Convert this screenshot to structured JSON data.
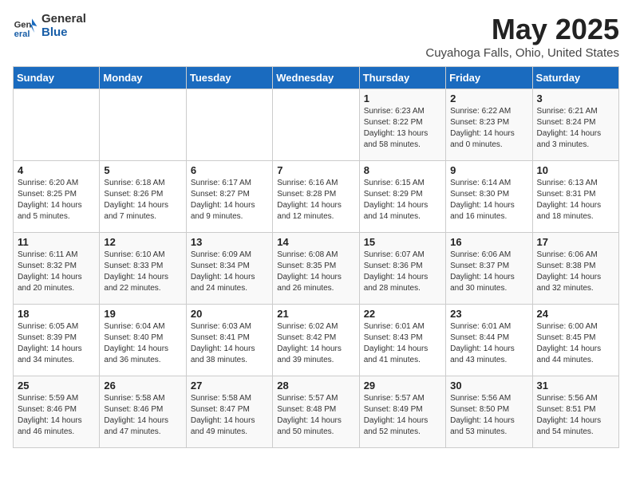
{
  "header": {
    "logo_general": "General",
    "logo_blue": "Blue",
    "title": "May 2025",
    "subtitle": "Cuyahoga Falls, Ohio, United States"
  },
  "weekdays": [
    "Sunday",
    "Monday",
    "Tuesday",
    "Wednesday",
    "Thursday",
    "Friday",
    "Saturday"
  ],
  "weeks": [
    [
      {
        "day": "",
        "info": ""
      },
      {
        "day": "",
        "info": ""
      },
      {
        "day": "",
        "info": ""
      },
      {
        "day": "",
        "info": ""
      },
      {
        "day": "1",
        "info": "Sunrise: 6:23 AM\nSunset: 8:22 PM\nDaylight: 13 hours\nand 58 minutes."
      },
      {
        "day": "2",
        "info": "Sunrise: 6:22 AM\nSunset: 8:23 PM\nDaylight: 14 hours\nand 0 minutes."
      },
      {
        "day": "3",
        "info": "Sunrise: 6:21 AM\nSunset: 8:24 PM\nDaylight: 14 hours\nand 3 minutes."
      }
    ],
    [
      {
        "day": "4",
        "info": "Sunrise: 6:20 AM\nSunset: 8:25 PM\nDaylight: 14 hours\nand 5 minutes."
      },
      {
        "day": "5",
        "info": "Sunrise: 6:18 AM\nSunset: 8:26 PM\nDaylight: 14 hours\nand 7 minutes."
      },
      {
        "day": "6",
        "info": "Sunrise: 6:17 AM\nSunset: 8:27 PM\nDaylight: 14 hours\nand 9 minutes."
      },
      {
        "day": "7",
        "info": "Sunrise: 6:16 AM\nSunset: 8:28 PM\nDaylight: 14 hours\nand 12 minutes."
      },
      {
        "day": "8",
        "info": "Sunrise: 6:15 AM\nSunset: 8:29 PM\nDaylight: 14 hours\nand 14 minutes."
      },
      {
        "day": "9",
        "info": "Sunrise: 6:14 AM\nSunset: 8:30 PM\nDaylight: 14 hours\nand 16 minutes."
      },
      {
        "day": "10",
        "info": "Sunrise: 6:13 AM\nSunset: 8:31 PM\nDaylight: 14 hours\nand 18 minutes."
      }
    ],
    [
      {
        "day": "11",
        "info": "Sunrise: 6:11 AM\nSunset: 8:32 PM\nDaylight: 14 hours\nand 20 minutes."
      },
      {
        "day": "12",
        "info": "Sunrise: 6:10 AM\nSunset: 8:33 PM\nDaylight: 14 hours\nand 22 minutes."
      },
      {
        "day": "13",
        "info": "Sunrise: 6:09 AM\nSunset: 8:34 PM\nDaylight: 14 hours\nand 24 minutes."
      },
      {
        "day": "14",
        "info": "Sunrise: 6:08 AM\nSunset: 8:35 PM\nDaylight: 14 hours\nand 26 minutes."
      },
      {
        "day": "15",
        "info": "Sunrise: 6:07 AM\nSunset: 8:36 PM\nDaylight: 14 hours\nand 28 minutes."
      },
      {
        "day": "16",
        "info": "Sunrise: 6:06 AM\nSunset: 8:37 PM\nDaylight: 14 hours\nand 30 minutes."
      },
      {
        "day": "17",
        "info": "Sunrise: 6:06 AM\nSunset: 8:38 PM\nDaylight: 14 hours\nand 32 minutes."
      }
    ],
    [
      {
        "day": "18",
        "info": "Sunrise: 6:05 AM\nSunset: 8:39 PM\nDaylight: 14 hours\nand 34 minutes."
      },
      {
        "day": "19",
        "info": "Sunrise: 6:04 AM\nSunset: 8:40 PM\nDaylight: 14 hours\nand 36 minutes."
      },
      {
        "day": "20",
        "info": "Sunrise: 6:03 AM\nSunset: 8:41 PM\nDaylight: 14 hours\nand 38 minutes."
      },
      {
        "day": "21",
        "info": "Sunrise: 6:02 AM\nSunset: 8:42 PM\nDaylight: 14 hours\nand 39 minutes."
      },
      {
        "day": "22",
        "info": "Sunrise: 6:01 AM\nSunset: 8:43 PM\nDaylight: 14 hours\nand 41 minutes."
      },
      {
        "day": "23",
        "info": "Sunrise: 6:01 AM\nSunset: 8:44 PM\nDaylight: 14 hours\nand 43 minutes."
      },
      {
        "day": "24",
        "info": "Sunrise: 6:00 AM\nSunset: 8:45 PM\nDaylight: 14 hours\nand 44 minutes."
      }
    ],
    [
      {
        "day": "25",
        "info": "Sunrise: 5:59 AM\nSunset: 8:46 PM\nDaylight: 14 hours\nand 46 minutes."
      },
      {
        "day": "26",
        "info": "Sunrise: 5:58 AM\nSunset: 8:46 PM\nDaylight: 14 hours\nand 47 minutes."
      },
      {
        "day": "27",
        "info": "Sunrise: 5:58 AM\nSunset: 8:47 PM\nDaylight: 14 hours\nand 49 minutes."
      },
      {
        "day": "28",
        "info": "Sunrise: 5:57 AM\nSunset: 8:48 PM\nDaylight: 14 hours\nand 50 minutes."
      },
      {
        "day": "29",
        "info": "Sunrise: 5:57 AM\nSunset: 8:49 PM\nDaylight: 14 hours\nand 52 minutes."
      },
      {
        "day": "30",
        "info": "Sunrise: 5:56 AM\nSunset: 8:50 PM\nDaylight: 14 hours\nand 53 minutes."
      },
      {
        "day": "31",
        "info": "Sunrise: 5:56 AM\nSunset: 8:51 PM\nDaylight: 14 hours\nand 54 minutes."
      }
    ]
  ]
}
